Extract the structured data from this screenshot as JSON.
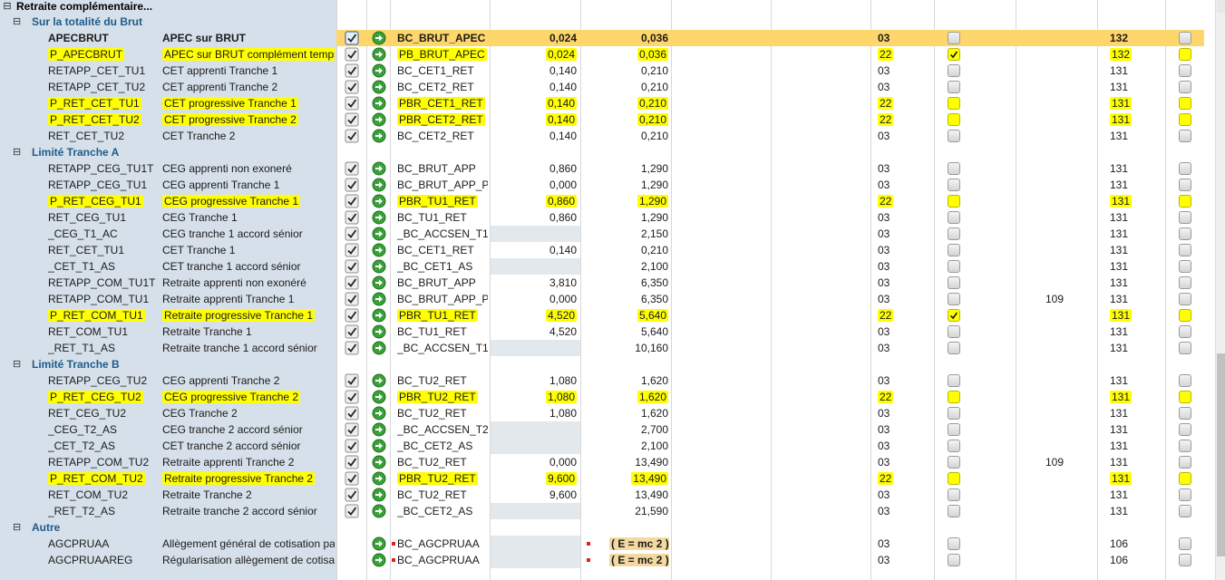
{
  "section_title": "Retraite complémentaire...",
  "scrollbar": {
    "thumb_start": 0.61,
    "thumb_end": 0.96
  },
  "rows": [
    {
      "kind": "group",
      "toggle": "⊟",
      "label": "Sur la totalité du Brut"
    },
    {
      "kind": "data",
      "highlight": true,
      "bold": true,
      "code": "APECBRUT",
      "label": "APEC sur BRUT",
      "base": "BC_BRUT_APEC",
      "rate1": "0,024",
      "rate2": "0,036",
      "c1": "03",
      "box1": "empty",
      "c2": "",
      "c3": "132",
      "box2": "empty",
      "check_pressed": true
    },
    {
      "kind": "data",
      "code": "P_APECBRUT",
      "code_mark": true,
      "label": "APEC sur BRUT complément temps p...",
      "label_mark": true,
      "base": "PB_BRUT_APEC",
      "base_mark": true,
      "rate1": "0,024",
      "rate1_mark": true,
      "rate2": "0,036",
      "rate2_mark": true,
      "c1": "22",
      "c1_mark": true,
      "box1": "checked-yellow",
      "c2": "",
      "c3": "132",
      "c3_mark": true,
      "box2": "yellow"
    },
    {
      "kind": "data",
      "code": "RETAPP_CET_TU1",
      "label": "CET apprenti Tranche 1",
      "base": "BC_CET1_RET",
      "rate1": "0,140",
      "rate2": "0,210",
      "c1": "03",
      "box1": "empty",
      "c2": "",
      "c3": "131",
      "box2": "empty"
    },
    {
      "kind": "data",
      "code": "RETAPP_CET_TU2",
      "label": "CET apprenti Tranche 2",
      "base": "BC_CET2_RET",
      "rate1": "0,140",
      "rate2": "0,210",
      "c1": "03",
      "box1": "empty",
      "c2": "",
      "c3": "131",
      "box2": "empty"
    },
    {
      "kind": "data",
      "code": "P_RET_CET_TU1",
      "code_mark": true,
      "label": "CET progressive Tranche 1",
      "label_mark": true,
      "base": "PBR_CET1_RET",
      "base_mark": true,
      "rate1": "0,140",
      "rate1_mark": true,
      "rate2": "0,210",
      "rate2_mark": true,
      "c1": "22",
      "c1_mark": true,
      "box1": "yellow",
      "c2": "",
      "c3": "131",
      "c3_mark": true,
      "box2": "yellow"
    },
    {
      "kind": "data",
      "code": "P_RET_CET_TU2",
      "code_mark": true,
      "label": "CET progressive Tranche 2",
      "label_mark": true,
      "base": "PBR_CET2_RET",
      "base_mark": true,
      "rate1": "0,140",
      "rate1_mark": true,
      "rate2": "0,210",
      "rate2_mark": true,
      "c1": "22",
      "c1_mark": true,
      "box1": "yellow",
      "c2": "",
      "c3": "131",
      "c3_mark": true,
      "box2": "yellow"
    },
    {
      "kind": "data",
      "code": "RET_CET_TU2",
      "label": "CET Tranche 2",
      "base": "BC_CET2_RET",
      "rate1": "0,140",
      "rate2": "0,210",
      "c1": "03",
      "box1": "empty",
      "c2": "",
      "c3": "131",
      "box2": "empty"
    },
    {
      "kind": "group",
      "toggle": "⊟",
      "label": "Limité Tranche A"
    },
    {
      "kind": "data",
      "code": "RETAPP_CEG_TU1T",
      "label": "CEG apprenti non exoneré",
      "base": "BC_BRUT_APP",
      "rate1": "0,860",
      "rate2": "1,290",
      "c1": "03",
      "box1": "empty",
      "c2": "",
      "c3": "131",
      "box2": "empty"
    },
    {
      "kind": "data",
      "code": "RETAPP_CEG_TU1",
      "label": "CEG apprenti Tranche 1",
      "base": "BC_BRUT_APP_PL",
      "rate1": "0,000",
      "rate2": "1,290",
      "c1": "03",
      "box1": "empty",
      "c2": "",
      "c3": "131",
      "box2": "empty"
    },
    {
      "kind": "data",
      "code": "P_RET_CEG_TU1",
      "code_mark": true,
      "label": "CEG progressive Tranche 1",
      "label_mark": true,
      "base": "PBR_TU1_RET",
      "base_mark": true,
      "rate1": "0,860",
      "rate1_mark": true,
      "rate2": "1,290",
      "rate2_mark": true,
      "c1": "22",
      "c1_mark": true,
      "box1": "yellow",
      "c2": "",
      "c3": "131",
      "c3_mark": true,
      "box2": "yellow"
    },
    {
      "kind": "data",
      "code": "RET_CEG_TU1",
      "label": "CEG Tranche 1",
      "base": "BC_TU1_RET",
      "rate1": "0,860",
      "rate2": "1,290",
      "c1": "03",
      "box1": "empty",
      "c2": "",
      "c3": "131",
      "box2": "empty"
    },
    {
      "kind": "data",
      "code": "_CEG_T1_AC",
      "label": "CEG tranche 1 accord sénior",
      "base": "_BC_ACCSEN_T1",
      "rate1": "",
      "gray": true,
      "rate2": "2,150",
      "c1": "03",
      "box1": "empty",
      "c2": "",
      "c3": "131",
      "box2": "empty"
    },
    {
      "kind": "data",
      "code": "RET_CET_TU1",
      "label": "CET Tranche 1",
      "base": "BC_CET1_RET",
      "rate1": "0,140",
      "rate2": "0,210",
      "c1": "03",
      "box1": "empty",
      "c2": "",
      "c3": "131",
      "box2": "empty"
    },
    {
      "kind": "data",
      "code": "_CET_T1_AS",
      "label": "CET tranche 1 accord sénior",
      "base": "_BC_CET1_AS",
      "rate1": "",
      "gray": true,
      "rate2": "2,100",
      "c1": "03",
      "box1": "empty",
      "c2": "",
      "c3": "131",
      "box2": "empty"
    },
    {
      "kind": "data",
      "code": "RETAPP_COM_TU1T",
      "label": "Retraite apprenti non exonéré",
      "base": "BC_BRUT_APP",
      "rate1": "3,810",
      "rate2": "6,350",
      "c1": "03",
      "box1": "empty",
      "c2": "",
      "c3": "131",
      "box2": "empty"
    },
    {
      "kind": "data",
      "code": "RETAPP_COM_TU1",
      "label": "Retraite apprenti Tranche 1",
      "base": "BC_BRUT_APP_PL",
      "rate1": "0,000",
      "rate2": "6,350",
      "c1": "03",
      "box1": "empty",
      "c2": "109",
      "c3": "131",
      "box2": "empty"
    },
    {
      "kind": "data",
      "code": "P_RET_COM_TU1",
      "code_mark": true,
      "label": "Retraite progressive Tranche 1",
      "label_mark": true,
      "base": "PBR_TU1_RET",
      "base_mark": true,
      "rate1": "4,520",
      "rate1_mark": true,
      "rate2": "5,640",
      "rate2_mark": true,
      "c1": "22",
      "c1_mark": true,
      "box1": "checked-yellow",
      "c2": "",
      "c3": "131",
      "c3_mark": true,
      "box2": "yellow"
    },
    {
      "kind": "data",
      "code": "RET_COM_TU1",
      "label": "Retraite Tranche 1",
      "base": "BC_TU1_RET",
      "rate1": "4,520",
      "rate2": "5,640",
      "c1": "03",
      "box1": "empty",
      "c2": "",
      "c3": "131",
      "box2": "empty"
    },
    {
      "kind": "data",
      "code": "_RET_T1_AS",
      "label": "Retraite tranche 1 accord sénior",
      "base": "_BC_ACCSEN_T1",
      "rate1": "",
      "gray": true,
      "rate2": "10,160",
      "c1": "03",
      "box1": "empty",
      "c2": "",
      "c3": "131",
      "box2": "empty"
    },
    {
      "kind": "group",
      "toggle": "⊟",
      "label": "Limité Tranche B"
    },
    {
      "kind": "data",
      "code": "RETAPP_CEG_TU2",
      "label": "CEG apprenti Tranche 2",
      "base": "BC_TU2_RET",
      "rate1": "1,080",
      "rate2": "1,620",
      "c1": "03",
      "box1": "empty",
      "c2": "",
      "c3": "131",
      "box2": "empty"
    },
    {
      "kind": "data",
      "code": "P_RET_CEG_TU2",
      "code_mark": true,
      "label": "CEG progressive Tranche 2",
      "label_mark": true,
      "base": "PBR_TU2_RET",
      "base_mark": true,
      "rate1": "1,080",
      "rate1_mark": true,
      "rate2": "1,620",
      "rate2_mark": true,
      "c1": "22",
      "c1_mark": true,
      "box1": "yellow",
      "c2": "",
      "c3": "131",
      "c3_mark": true,
      "box2": "yellow"
    },
    {
      "kind": "data",
      "code": "RET_CEG_TU2",
      "label": "CEG Tranche 2",
      "base": "BC_TU2_RET",
      "rate1": "1,080",
      "rate2": "1,620",
      "c1": "03",
      "box1": "empty",
      "c2": "",
      "c3": "131",
      "box2": "empty"
    },
    {
      "kind": "data",
      "code": "_CEG_T2_AS",
      "label": "CEG tranche 2 accord sénior",
      "base": "_BC_ACCSEN_T2",
      "rate1": "",
      "gray": true,
      "rate2": "2,700",
      "c1": "03",
      "box1": "empty",
      "c2": "",
      "c3": "131",
      "box2": "empty"
    },
    {
      "kind": "data",
      "code": "_CET_T2_AS",
      "label": "CET tranche 2 accord sénior",
      "base": "_BC_CET2_AS",
      "rate1": "",
      "gray": true,
      "rate2": "2,100",
      "c1": "03",
      "box1": "empty",
      "c2": "",
      "c3": "131",
      "box2": "empty"
    },
    {
      "kind": "data",
      "code": "RETAPP_COM_TU2",
      "label": "Retraite apprenti Tranche 2",
      "base": "BC_TU2_RET",
      "rate1": "0,000",
      "rate2": "13,490",
      "c1": "03",
      "box1": "empty",
      "c2": "109",
      "c3": "131",
      "box2": "empty"
    },
    {
      "kind": "data",
      "code": "P_RET_COM_TU2",
      "code_mark": true,
      "label": "Retraite progressive Tranche 2",
      "label_mark": true,
      "base": "PBR_TU2_RET",
      "base_mark": true,
      "rate1": "9,600",
      "rate1_mark": true,
      "rate2": "13,490",
      "rate2_mark": true,
      "c1": "22",
      "c1_mark": true,
      "box1": "yellow",
      "c2": "",
      "c3": "131",
      "c3_mark": true,
      "box2": "yellow"
    },
    {
      "kind": "data",
      "code": "RET_COM_TU2",
      "label": "Retraite Tranche 2",
      "base": "BC_TU2_RET",
      "rate1": "9,600",
      "rate2": "13,490",
      "c1": "03",
      "box1": "empty",
      "c2": "",
      "c3": "131",
      "box2": "empty"
    },
    {
      "kind": "data",
      "code": "_RET_T2_AS",
      "label": "Retraite tranche 2 accord sénior",
      "base": "_BC_CET2_AS",
      "rate1": "",
      "gray": true,
      "rate2": "21,590",
      "c1": "03",
      "box1": "empty",
      "c2": "",
      "c3": "131",
      "box2": "empty"
    },
    {
      "kind": "group",
      "toggle": "⊟",
      "label": "Autre"
    },
    {
      "kind": "data",
      "code": "AGCPRUAA",
      "label": "Allègement général de cotisation part ...",
      "no_check": true,
      "base": "BC_AGCPRUAA",
      "base_dot": true,
      "rate1": "",
      "gray": true,
      "formula": "( E = mc 2 )",
      "c1": "03",
      "box1": "empty",
      "c2": "",
      "c3": "106",
      "box2": "empty"
    },
    {
      "kind": "data",
      "code": "AGCPRUAAREG",
      "label": "Régularisation allègement de cotisatio...",
      "no_check": true,
      "base": "BC_AGCPRUAA",
      "base_dot": true,
      "rate1": "",
      "gray": true,
      "formula": "( E = mc 2 )",
      "c1": "03",
      "box1": "empty",
      "c2": "",
      "c3": "106",
      "box2": "empty"
    }
  ]
}
